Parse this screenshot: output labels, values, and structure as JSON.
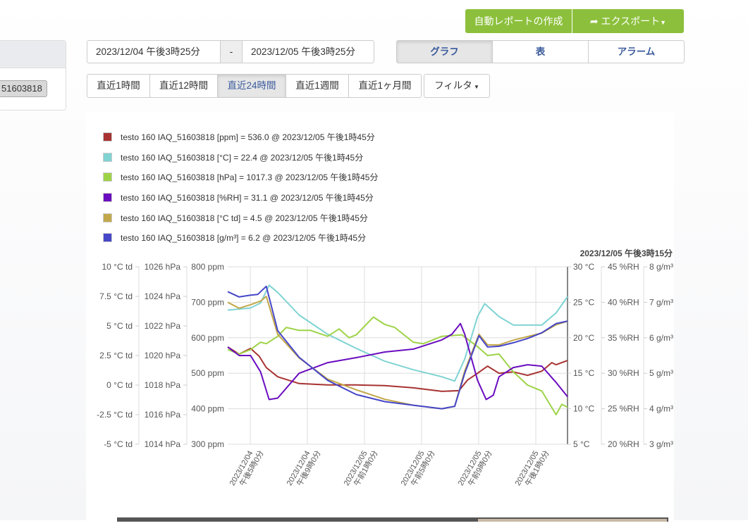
{
  "left_card": {
    "device_button": "51603818"
  },
  "actions": {
    "auto_report": "自動レポートの作成",
    "export": "エクスポート",
    "export_icon": "share-arrow-icon"
  },
  "date_range": {
    "from": "2023/12/04 午後3時25分",
    "separator": "-",
    "to": "2023/12/05 午後3時25分"
  },
  "view_tabs": [
    {
      "label": "グラフ",
      "active": true
    },
    {
      "label": "表",
      "active": false
    },
    {
      "label": "アラーム",
      "active": false
    }
  ],
  "range_buttons": [
    {
      "label": "直近1時間"
    },
    {
      "label": "直近12時間"
    },
    {
      "label": "直近24時間",
      "active": true
    },
    {
      "label": "直近1週間"
    },
    {
      "label": "直近1ヶ月間"
    }
  ],
  "filter_label": "フィルタ",
  "legend": [
    {
      "label": "testo 160 IAQ_51603818 [ppm] = 536.0 @ 2023/12/05 午後1時45分",
      "color": "#a83232"
    },
    {
      "label": "testo 160 IAQ_51603818 [°C] = 22.4 @ 2023/12/05 午後1時45分",
      "color": "#7fd3d3"
    },
    {
      "label": "testo 160 IAQ_51603818 [hPa] = 1017.3 @ 2023/12/05 午後1時45分",
      "color": "#9ed347"
    },
    {
      "label": "testo 160 IAQ_51603818 [%RH] = 31.1 @ 2023/12/05 午後1時45分",
      "color": "#6a0dbf"
    },
    {
      "label": "testo 160 IAQ_51603818 [°C td] = 4.5 @ 2023/12/05 午後1時45分",
      "color": "#c2a84a"
    },
    {
      "label": "testo 160 IAQ_51603818 [g/m³] = 6.2 @ 2023/12/05 午後1時45分",
      "color": "#4646c8"
    }
  ],
  "chart_data": {
    "type": "line",
    "cursor_label": "2023/12/05 午後3時15分",
    "x_unit": "hours since 2023/12/04 15:25",
    "x_range": [
      0,
      23.8
    ],
    "x_ticks": [
      {
        "x": 1.58,
        "line1": "2023/12/04",
        "line2": "午後5時0分"
      },
      {
        "x": 5.58,
        "line1": "2023/12/04",
        "line2": "午後9時0分"
      },
      {
        "x": 9.58,
        "line1": "2023/12/05",
        "line2": "午前1時0分"
      },
      {
        "x": 13.58,
        "line1": "2023/12/05",
        "line2": "午前5時0分"
      },
      {
        "x": 17.58,
        "line1": "2023/12/05",
        "line2": "午前9時0分"
      },
      {
        "x": 21.58,
        "line1": "2023/12/05",
        "line2": "午後1時0分"
      }
    ],
    "axes": {
      "ctd": {
        "range": [
          -5,
          10
        ],
        "ticks": [
          "10 °C td",
          "7.5 °C td",
          "5 °C td",
          "2.5 °C td",
          "0 °C td",
          "-2.5 °C td",
          "-5 °C td"
        ]
      },
      "hpa": {
        "range": [
          1014,
          1026
        ],
        "ticks": [
          "1026 hPa",
          "1024 hPa",
          "1022 hPa",
          "1020 hPa",
          "1018 hPa",
          "1016 hPa",
          "1014 hPa"
        ]
      },
      "ppm": {
        "range": [
          300,
          800
        ],
        "ticks": [
          "800 ppm",
          "700 ppm",
          "600 ppm",
          "500 ppm",
          "400 ppm",
          "300 ppm"
        ]
      },
      "c": {
        "range": [
          5,
          30
        ],
        "ticks": [
          "30 °C",
          "25 °C",
          "20 °C",
          "15 °C",
          "10 °C",
          "5 °C"
        ]
      },
      "rh": {
        "range": [
          20,
          45
        ],
        "ticks": [
          "45 %RH",
          "40 %RH",
          "35 %RH",
          "30 %RH",
          "25 %RH",
          "20 %RH"
        ]
      },
      "gm3": {
        "range": [
          3,
          8
        ],
        "ticks": [
          "8 g/m³",
          "7 g/m³",
          "6 g/m³",
          "5 g/m³",
          "4 g/m³",
          "3 g/m³"
        ]
      }
    },
    "series": [
      {
        "name": "ppm",
        "axis": "ppm",
        "color": "#a83232",
        "points": [
          [
            0,
            574
          ],
          [
            0.8,
            554
          ],
          [
            1.6,
            570
          ],
          [
            2.2,
            548
          ],
          [
            2.7,
            516
          ],
          [
            3.5,
            490
          ],
          [
            5,
            471
          ],
          [
            7,
            467
          ],
          [
            9,
            467
          ],
          [
            11,
            465
          ],
          [
            13,
            459
          ],
          [
            15,
            449
          ],
          [
            16.2,
            451
          ],
          [
            16.8,
            481
          ],
          [
            17.5,
            500
          ],
          [
            18.2,
            520
          ],
          [
            19,
            500
          ],
          [
            20,
            504
          ],
          [
            21,
            494
          ],
          [
            22,
            506
          ],
          [
            22.7,
            530
          ],
          [
            23,
            524
          ],
          [
            23.8,
            536
          ]
        ]
      },
      {
        "name": "°C",
        "axis": "c",
        "color": "#7fd3d3",
        "points": [
          [
            0,
            23.9
          ],
          [
            1.6,
            24.2
          ],
          [
            2.3,
            24.9
          ],
          [
            2.9,
            27.4
          ],
          [
            3.5,
            26.4
          ],
          [
            5,
            23.2
          ],
          [
            7,
            20.5
          ],
          [
            9,
            18.5
          ],
          [
            11,
            16.7
          ],
          [
            13,
            15.5
          ],
          [
            15,
            14.5
          ],
          [
            15.9,
            13.9
          ],
          [
            16.6,
            17
          ],
          [
            17.5,
            23
          ],
          [
            18,
            24.8
          ],
          [
            19,
            23
          ],
          [
            20,
            21.8
          ],
          [
            22,
            21.8
          ],
          [
            23,
            23.5
          ],
          [
            23.8,
            25.8
          ]
        ]
      },
      {
        "name": "hPa",
        "axis": "hpa",
        "color": "#9ed347",
        "points": [
          [
            0,
            1020.4
          ],
          [
            0.8,
            1020.1
          ],
          [
            1.6,
            1020.4
          ],
          [
            2.3,
            1020.9
          ],
          [
            2.7,
            1020.8
          ],
          [
            3.5,
            1021.3
          ],
          [
            4.1,
            1021.9
          ],
          [
            5,
            1021.7
          ],
          [
            5.8,
            1021.7
          ],
          [
            7,
            1021.3
          ],
          [
            7.8,
            1021.8
          ],
          [
            8.5,
            1021.2
          ],
          [
            9,
            1021.4
          ],
          [
            10.2,
            1022.6
          ],
          [
            11,
            1022.1
          ],
          [
            11.7,
            1021.9
          ],
          [
            13,
            1020.9
          ],
          [
            13.7,
            1020.8
          ],
          [
            15,
            1021.3
          ],
          [
            16.4,
            1021.4
          ],
          [
            17.5,
            1020.6
          ],
          [
            18.2,
            1020.0
          ],
          [
            19,
            1020.1
          ],
          [
            20,
            1018.9
          ],
          [
            21,
            1018.0
          ],
          [
            22,
            1017.6
          ],
          [
            23,
            1016.0
          ],
          [
            23.4,
            1016.7
          ],
          [
            23.8,
            1016.5
          ]
        ]
      },
      {
        "name": "%RH",
        "axis": "rh",
        "color": "#6a0dbf",
        "points": [
          [
            0,
            33.7
          ],
          [
            0.8,
            32.5
          ],
          [
            1.6,
            32.5
          ],
          [
            2.3,
            30.2
          ],
          [
            2.9,
            26.3
          ],
          [
            3.5,
            26.5
          ],
          [
            5,
            30
          ],
          [
            7,
            31.5
          ],
          [
            9,
            32.2
          ],
          [
            11,
            33
          ],
          [
            13,
            33.4
          ],
          [
            15,
            34.7
          ],
          [
            15.7,
            35.5
          ],
          [
            16.3,
            37
          ],
          [
            16.6,
            35.5
          ],
          [
            17.5,
            29
          ],
          [
            18.1,
            26.3
          ],
          [
            18.6,
            26.9
          ],
          [
            19,
            29.5
          ],
          [
            20,
            30.8
          ],
          [
            21,
            31.2
          ],
          [
            22,
            31
          ],
          [
            23,
            28.7
          ],
          [
            23.8,
            26.7
          ]
        ]
      },
      {
        "name": "°C td",
        "axis": "ctd",
        "color": "#c2a84a",
        "points": [
          [
            0,
            7
          ],
          [
            0.8,
            6.5
          ],
          [
            1.6,
            6.8
          ],
          [
            2.3,
            7.1
          ],
          [
            2.7,
            7.5
          ],
          [
            3.5,
            4.3
          ],
          [
            5,
            2.3
          ],
          [
            7,
            0.5
          ],
          [
            9,
            -0.4
          ],
          [
            11,
            -1.2
          ],
          [
            13,
            -1.7
          ],
          [
            15,
            -2
          ],
          [
            15.9,
            -1.8
          ],
          [
            16.6,
            1.2
          ],
          [
            17.6,
            4.3
          ],
          [
            18.2,
            3.4
          ],
          [
            19,
            3.4
          ],
          [
            20,
            3.8
          ],
          [
            21,
            4.1
          ],
          [
            22,
            4.4
          ],
          [
            23,
            5.1
          ],
          [
            23.8,
            5.4
          ]
        ]
      },
      {
        "name": "g/m³",
        "axis": "gm3",
        "color": "#4646c8",
        "points": [
          [
            0,
            7.3
          ],
          [
            0.8,
            7.15
          ],
          [
            1.6,
            7.2
          ],
          [
            2.1,
            7.22
          ],
          [
            2.7,
            7.45
          ],
          [
            3.5,
            6.2
          ],
          [
            5,
            5.45
          ],
          [
            7,
            4.8
          ],
          [
            9,
            4.4
          ],
          [
            11,
            4.2
          ],
          [
            13,
            4.1
          ],
          [
            15,
            4.0
          ],
          [
            15.9,
            4.07
          ],
          [
            16.6,
            5.0
          ],
          [
            17.6,
            6.06
          ],
          [
            18.2,
            5.74
          ],
          [
            19,
            5.76
          ],
          [
            20,
            5.86
          ],
          [
            21,
            5.98
          ],
          [
            22,
            6.14
          ],
          [
            23,
            6.4
          ],
          [
            23.8,
            6.47
          ]
        ]
      }
    ]
  }
}
